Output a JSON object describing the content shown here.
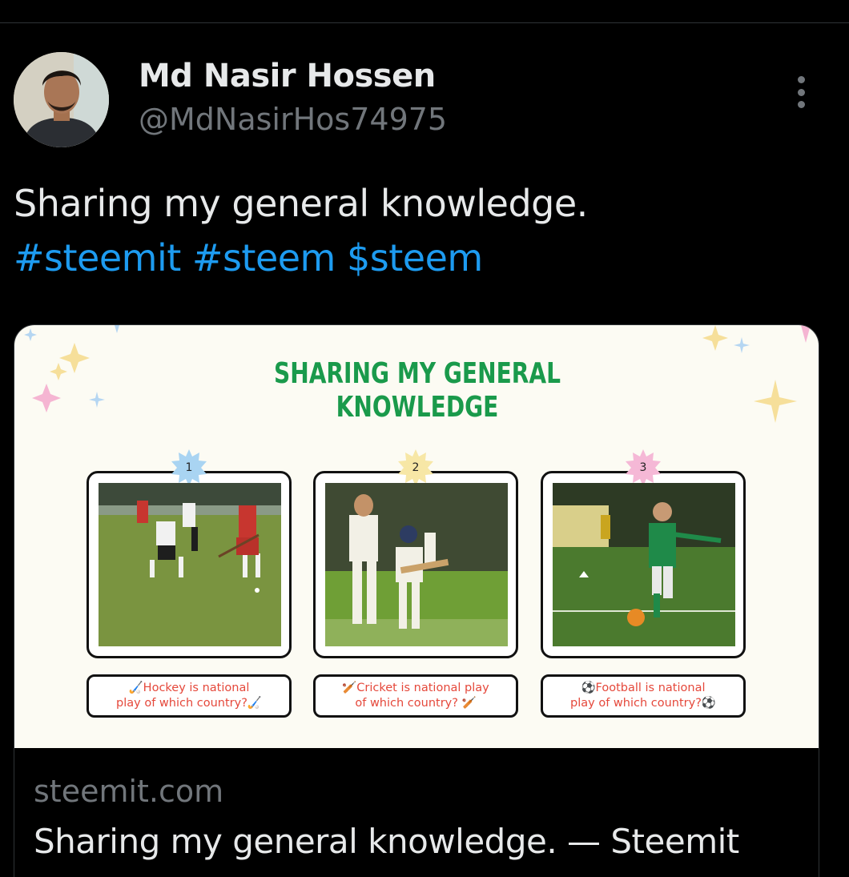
{
  "author": {
    "display_name": "Md Nasir Hossen",
    "handle": "@MdNasirHos74975"
  },
  "tweet": {
    "text": "Sharing my general knowledge.",
    "hashtags": [
      "#steemit",
      "#steem",
      "$steem"
    ]
  },
  "card": {
    "image": {
      "title_line1": "SHARING MY GENERAL",
      "title_line2": "KNOWLEDGE",
      "panels": [
        {
          "number": "1",
          "badge_color": "#a9d4f2",
          "photo": "hockey-photo",
          "caption_line1": "🏑Hockey is national",
          "caption_line2": "play of which country?🏑"
        },
        {
          "number": "2",
          "badge_color": "#f7e7a6",
          "photo": "cricket-photo",
          "caption_line1": "🏏Cricket is national play",
          "caption_line2": "of which country? 🏏"
        },
        {
          "number": "3",
          "badge_color": "#f5b8d6",
          "photo": "football-photo",
          "caption_line1": "⚽Football is national",
          "caption_line2": "play of which country?⚽"
        }
      ],
      "accent_color": "#1a9a4b",
      "caption_color": "#e5483b"
    },
    "domain": "steemit.com",
    "title": "Sharing my general knowledge. — Steemit"
  },
  "colors": {
    "background": "#000000",
    "link": "#1d9bf0",
    "secondary_text": "#71767b"
  },
  "icons": {
    "more": "more-dots-icon"
  }
}
